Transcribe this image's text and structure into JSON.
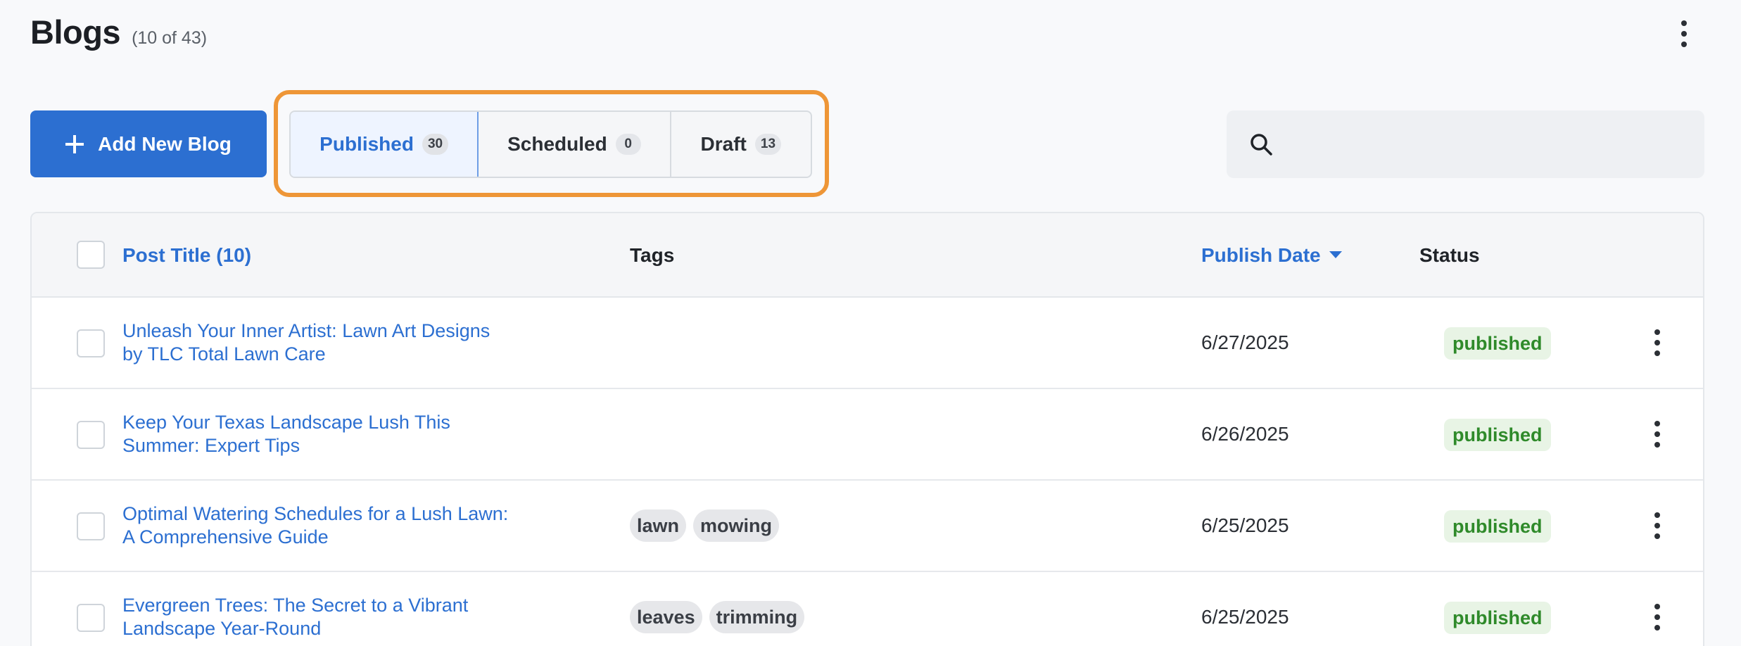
{
  "header": {
    "title": "Blogs",
    "count": "(10 of 43)"
  },
  "toolbar": {
    "add_label": "Add New Blog",
    "tabs": [
      {
        "label": "Published",
        "count": "30",
        "active": true
      },
      {
        "label": "Scheduled",
        "count": "0",
        "active": false
      },
      {
        "label": "Draft",
        "count": "13",
        "active": false
      }
    ],
    "search_placeholder": ""
  },
  "table": {
    "columns": {
      "title": "Post Title (10)",
      "tags": "Tags",
      "date": "Publish Date",
      "status": "Status"
    },
    "rows": [
      {
        "title_line1": "Unleash Your Inner Artist: Lawn Art Designs",
        "title_line2": "by TLC Total Lawn Care",
        "tags": [],
        "date": "6/27/2025",
        "status": "published"
      },
      {
        "title_line1": "Keep Your Texas Landscape Lush This",
        "title_line2": "Summer: Expert Tips",
        "tags": [],
        "date": "6/26/2025",
        "status": "published"
      },
      {
        "title_line1": "Optimal Watering Schedules for a Lush Lawn:",
        "title_line2": "A Comprehensive Guide",
        "tags": [
          "lawn",
          "mowing"
        ],
        "date": "6/25/2025",
        "status": "published"
      },
      {
        "title_line1": "Evergreen Trees: The Secret to a Vibrant",
        "title_line2": "Landscape Year-Round",
        "tags": [
          "leaves",
          "trimming"
        ],
        "date": "6/25/2025",
        "status": "published"
      }
    ]
  },
  "colors": {
    "accent": "#2c6fd1",
    "highlight": "#ee9637",
    "status_green": "#2f8a2a"
  },
  "icons": [
    "plus-icon",
    "search-icon",
    "more-vertical-icon"
  ]
}
